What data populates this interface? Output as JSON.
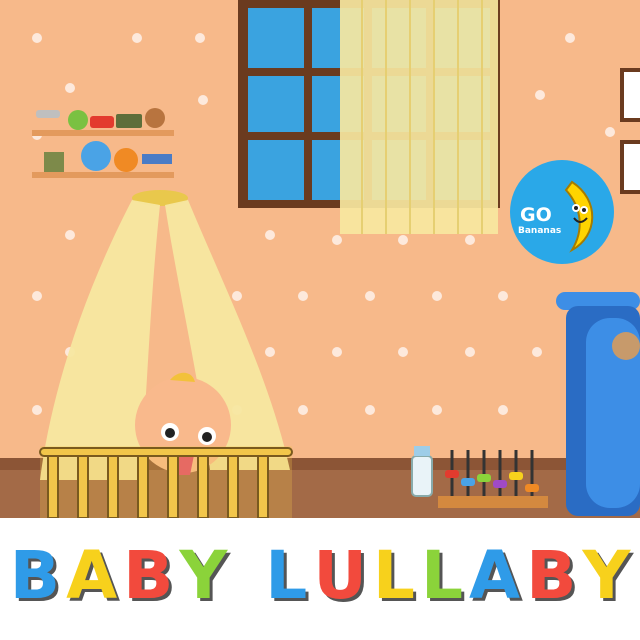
{
  "logo": {
    "go_text": "GO",
    "brand_text": "Bananas",
    "bg_color": "#2aa8e8",
    "banana_color": "#ffd400"
  },
  "title": {
    "text": "BABY LULLABY",
    "letters": [
      {
        "ch": "B",
        "color": "#2f9be8"
      },
      {
        "ch": "A",
        "color": "#f7d11c"
      },
      {
        "ch": "B",
        "color": "#f24a3d"
      },
      {
        "ch": "Y",
        "color": "#8bd33a"
      },
      {
        "ch": " ",
        "color": ""
      },
      {
        "ch": "L",
        "color": "#2f9be8"
      },
      {
        "ch": "U",
        "color": "#f24a3d"
      },
      {
        "ch": "L",
        "color": "#f7d11c"
      },
      {
        "ch": "L",
        "color": "#8bd33a"
      },
      {
        "ch": "A",
        "color": "#2f9be8"
      },
      {
        "ch": "B",
        "color": "#f24a3d"
      },
      {
        "ch": "Y",
        "color": "#f7d11c"
      }
    ]
  },
  "colors": {
    "wall": "#f7b98a",
    "floor": "#a36a47",
    "curtain": "#f7e7a0",
    "crib": "#f2c64a",
    "stroller": "#3d8ee6"
  }
}
